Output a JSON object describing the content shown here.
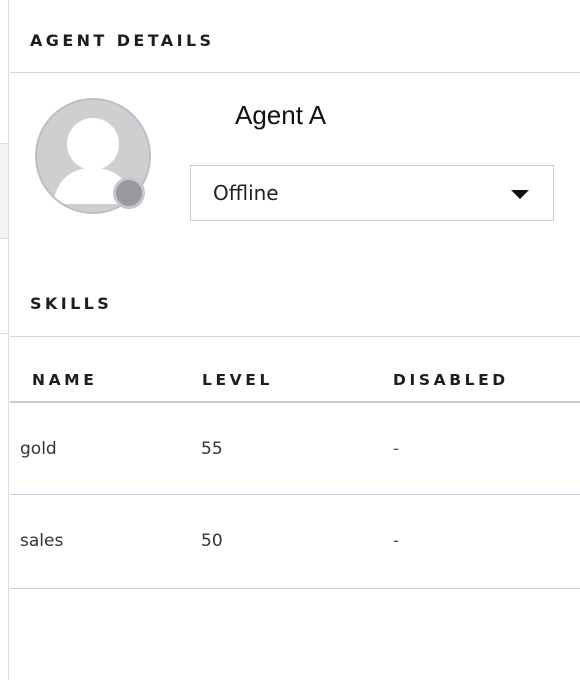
{
  "agent_details": {
    "title": "AGENT DETAILS",
    "agent_name": "Agent A",
    "avatar": "user-avatar-placeholder",
    "status": {
      "value": "Offline",
      "indicator_color": "#9a9a9a",
      "icon": "caret-down-icon"
    }
  },
  "skills": {
    "title": "SKILLS",
    "columns": [
      "NAME",
      "LEVEL",
      "DISABLED"
    ],
    "rows": [
      {
        "name": "gold",
        "level": "55",
        "disabled": "-"
      },
      {
        "name": "sales",
        "level": "50",
        "disabled": "-"
      }
    ]
  }
}
